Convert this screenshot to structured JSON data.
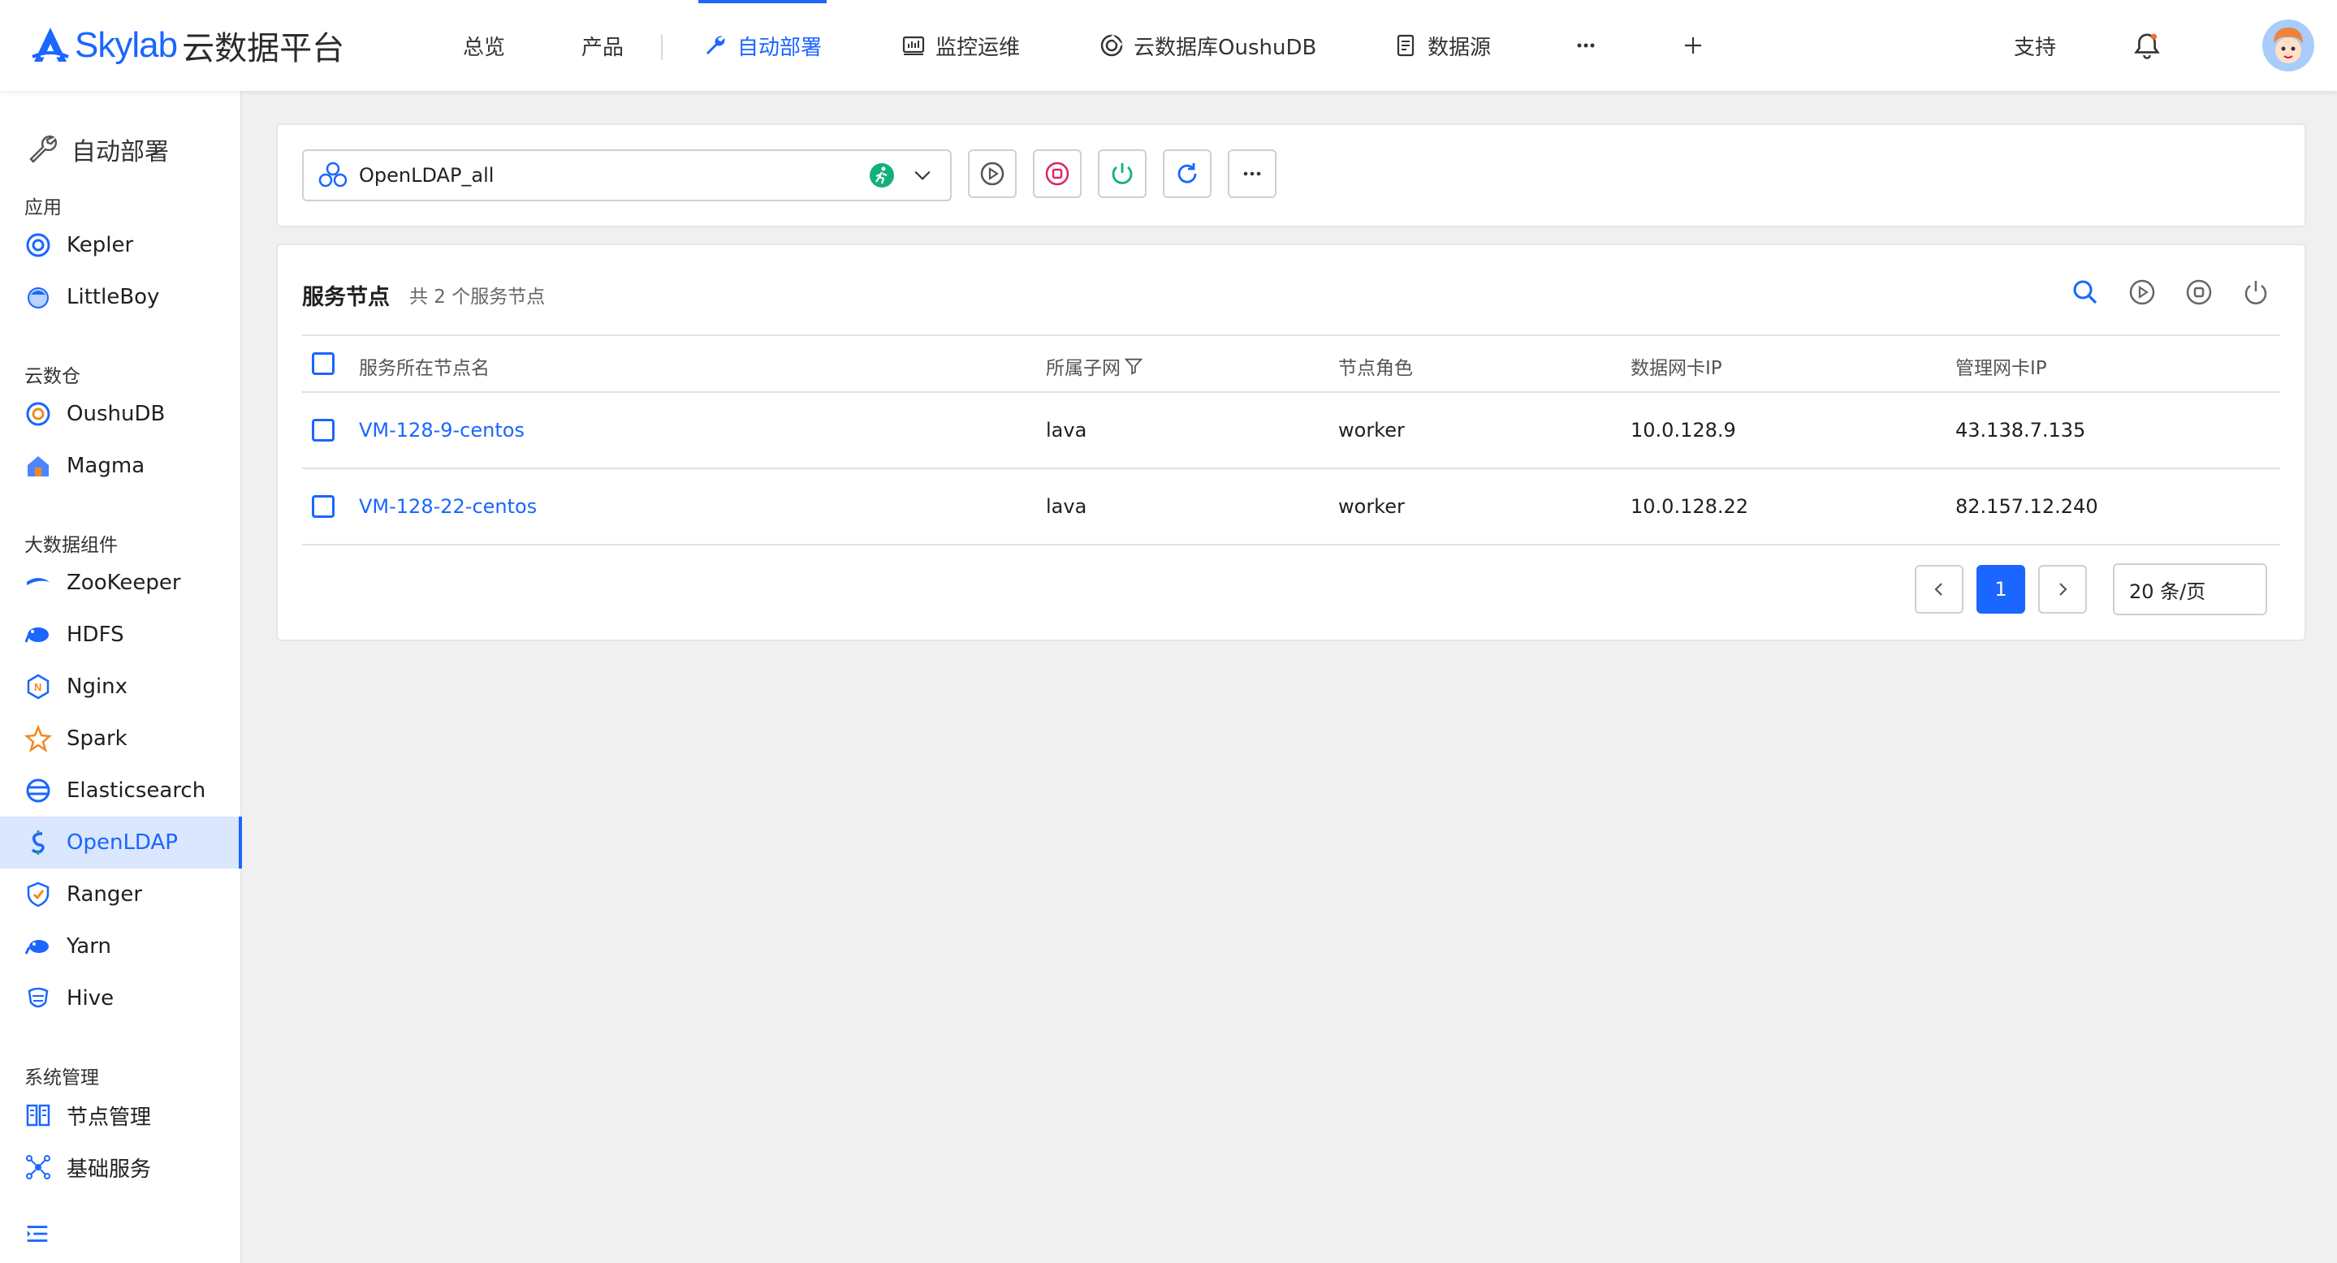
{
  "header": {
    "brand": "Skylab",
    "brand_cn": "云数据平台",
    "nav": [
      "总览",
      "产品",
      "自动部署",
      "监控运维",
      "云数据库OushuDB",
      "数据源"
    ],
    "support": "支持"
  },
  "sidebar": {
    "title": "自动部署",
    "groups": [
      "应用",
      "云数仓",
      "大数据组件",
      "系统管理"
    ],
    "items": [
      "Kepler",
      "LittleBoy",
      "OushuDB",
      "Magma",
      "ZooKeeper",
      "HDFS",
      "Nginx",
      "Spark",
      "Elasticsearch",
      "OpenLDAP",
      "Ranger",
      "Yarn",
      "Hive",
      "节点管理",
      "基础服务"
    ]
  },
  "cluster_select": {
    "value": "OpenLDAP_all"
  },
  "nodes_panel": {
    "title": "服务节点",
    "subtitle": "共 2 个服务节点",
    "columns": [
      "服务所在节点名",
      "所属子网",
      "节点角色",
      "数据网卡IP",
      "管理网卡IP"
    ],
    "rows": [
      {
        "name": "VM-128-9-centos",
        "subnet": "lava",
        "role": "worker",
        "data_ip": "10.0.128.9",
        "mgmt_ip": "43.138.7.135"
      },
      {
        "name": "VM-128-22-centos",
        "subnet": "lava",
        "role": "worker",
        "data_ip": "10.0.128.22",
        "mgmt_ip": "82.157.12.240"
      }
    ]
  },
  "pagination": {
    "current": "1",
    "page_size": "20 条/页"
  },
  "colors": {
    "accent": "#1a66ff",
    "danger": "#e0245e",
    "success": "#14b07a",
    "running": "#14b07a"
  }
}
